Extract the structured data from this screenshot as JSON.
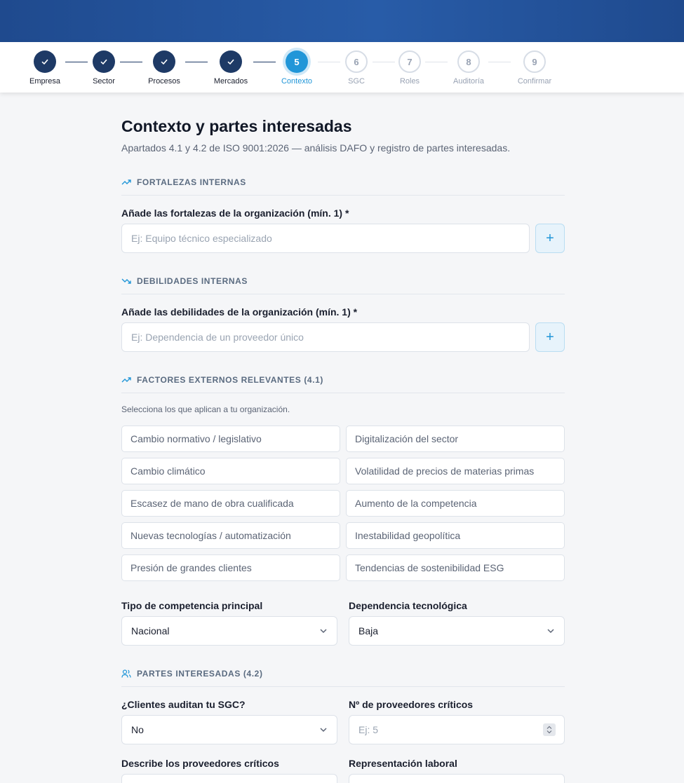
{
  "stepper": {
    "steps": [
      {
        "num": "1",
        "label": "Empresa",
        "state": "done"
      },
      {
        "num": "2",
        "label": "Sector",
        "state": "done"
      },
      {
        "num": "3",
        "label": "Procesos",
        "state": "done"
      },
      {
        "num": "4",
        "label": "Mercados",
        "state": "done"
      },
      {
        "num": "5",
        "label": "Contexto",
        "state": "active"
      },
      {
        "num": "6",
        "label": "SGC",
        "state": "todo"
      },
      {
        "num": "7",
        "label": "Roles",
        "state": "todo"
      },
      {
        "num": "8",
        "label": "Auditoría",
        "state": "todo"
      },
      {
        "num": "9",
        "label": "Confirmar",
        "state": "todo"
      }
    ]
  },
  "page": {
    "title": "Contexto y partes interesadas",
    "subtitle": "Apartados 4.1 y 4.2 de ISO 9001:2026 — análisis DAFO y registro de partes interesadas."
  },
  "strengths": {
    "heading": "FORTALEZAS INTERNAS",
    "label": "Añade las fortalezas de la organización (mín. 1) *",
    "placeholder": "Ej: Equipo técnico especializado",
    "add": "+"
  },
  "weaknesses": {
    "heading": "DEBILIDADES INTERNAS",
    "label": "Añade las debilidades de la organización (mín. 1) *",
    "placeholder": "Ej: Dependencia de un proveedor único",
    "add": "+"
  },
  "external": {
    "heading": "FACTORES EXTERNOS RELEVANTES (4.1)",
    "hint": "Selecciona los que aplican a tu organización.",
    "options": [
      "Cambio normativo / legislativo",
      "Digitalización del sector",
      "Cambio climático",
      "Volatilidad de precios de materias primas",
      "Escasez de mano de obra cualificada",
      "Aumento de la competencia",
      "Nuevas tecnologías / automatización",
      "Inestabilidad geopolítica",
      "Presión de grandes clientes",
      "Tendencias de sostenibilidad ESG"
    ]
  },
  "competition": {
    "label": "Tipo de competencia principal",
    "value": "Nacional"
  },
  "tech_dependency": {
    "label": "Dependencia tecnológica",
    "value": "Baja"
  },
  "stakeholders": {
    "heading": "PARTES INTERESADAS (4.2)",
    "clients_audit": {
      "label": "¿Clientes auditan tu SGC?",
      "value": "No"
    },
    "critical_suppliers": {
      "label": "Nº de proveedores críticos",
      "placeholder": "Ej: 5"
    },
    "describe_suppliers": {
      "label": "Describe los proveedores críticos"
    },
    "labor_rep": {
      "label": "Representación laboral"
    }
  },
  "colors": {
    "accent": "#2196d8",
    "done": "#1e3a66",
    "header": "#285ca8"
  }
}
